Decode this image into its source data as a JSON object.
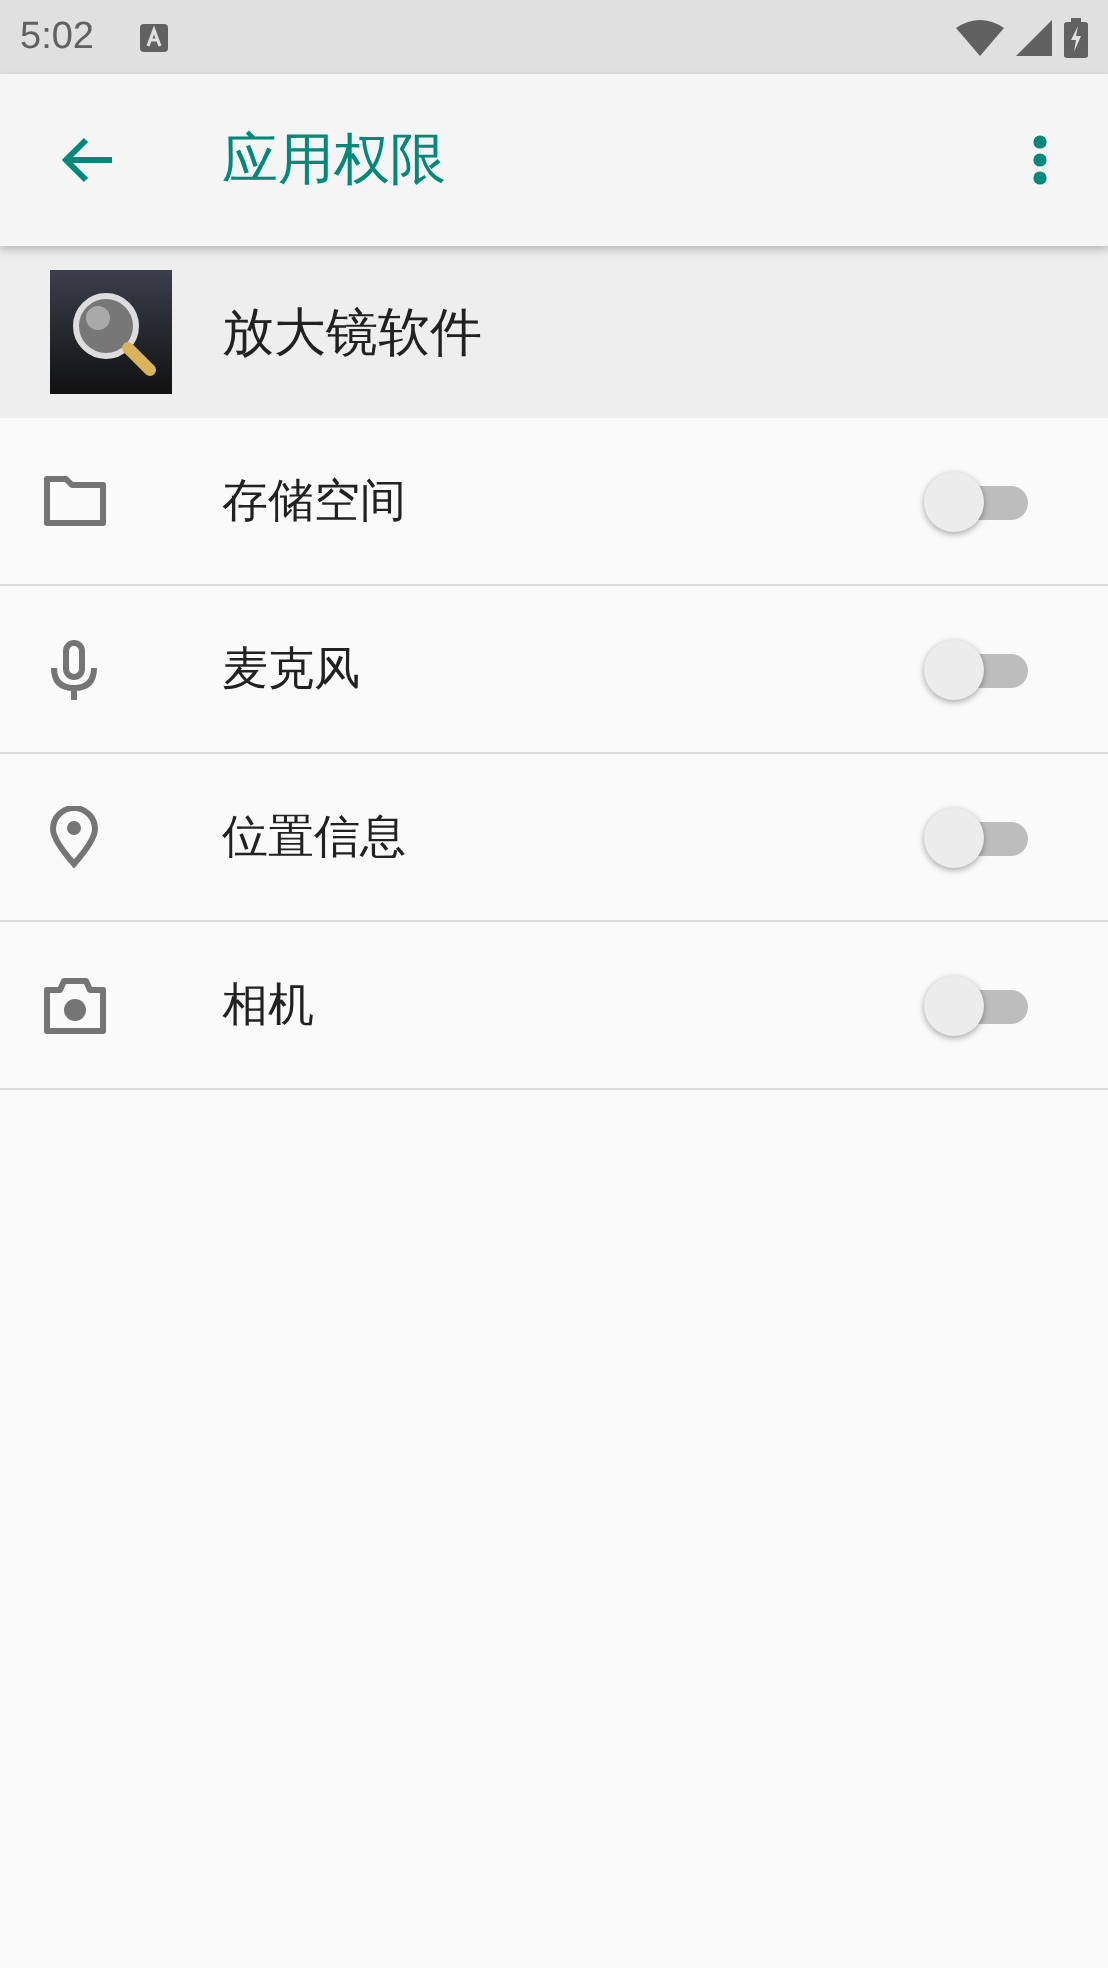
{
  "status_bar": {
    "time": "5:02"
  },
  "app_bar": {
    "title": "应用权限"
  },
  "app": {
    "name": "放大镜软件"
  },
  "permissions": [
    {
      "kind": "folder",
      "label": "存储空间",
      "on": false
    },
    {
      "kind": "mic",
      "label": "麦克风",
      "on": false
    },
    {
      "kind": "location",
      "label": "位置信息",
      "on": false
    },
    {
      "kind": "camera",
      "label": "相机",
      "on": false
    }
  ]
}
